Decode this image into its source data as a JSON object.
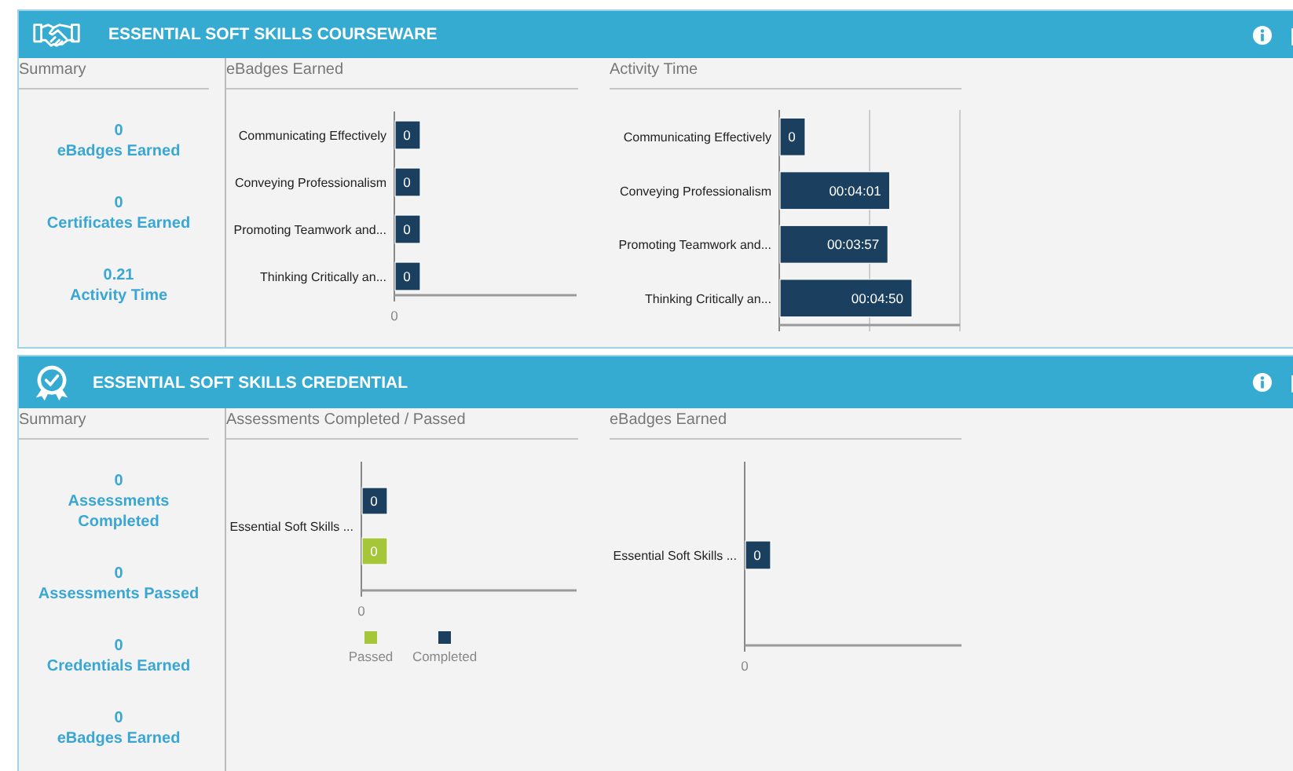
{
  "panels": [
    {
      "kind": "handshake",
      "title": "ESSENTIAL SOFT SKILLS COURSEWARE",
      "summary_title": "Summary",
      "summary": [
        {
          "value": "0",
          "label": "eBadges Earned"
        },
        {
          "value": "0",
          "label": "Certificates Earned"
        },
        {
          "value": "0.21",
          "label": "Activity Time"
        }
      ],
      "charts": [
        {
          "title": "eBadges Earned",
          "axis_origin": "0",
          "rows": [
            {
              "category": "Communicating Effectively",
              "bars": [
                {
                  "value": "0",
                  "color": "#1b3f5e"
                }
              ]
            },
            {
              "category": "Conveying Professionalism",
              "bars": [
                {
                  "value": "0",
                  "color": "#1b3f5e"
                }
              ]
            },
            {
              "category": "Promoting Teamwork and...",
              "bars": [
                {
                  "value": "0",
                  "color": "#1b3f5e"
                }
              ]
            },
            {
              "category": "Thinking Critically an...",
              "bars": [
                {
                  "value": "0",
                  "color": "#1b3f5e"
                }
              ]
            }
          ]
        },
        {
          "title": "Activity Time",
          "rows": [
            {
              "category": "Communicating Effectively",
              "bars": [
                {
                  "value": "0",
                  "color": "#1b3f5e"
                }
              ]
            },
            {
              "category": "Conveying Professionalism",
              "bars": [
                {
                  "value": "00:04:01",
                  "color": "#1b3f5e"
                }
              ]
            },
            {
              "category": "Promoting Teamwork and...",
              "bars": [
                {
                  "value": "00:03:57",
                  "color": "#1b3f5e"
                }
              ]
            },
            {
              "category": "Thinking Critically an...",
              "bars": [
                {
                  "value": "00:04:50",
                  "color": "#1b3f5e"
                }
              ]
            }
          ]
        }
      ]
    },
    {
      "kind": "award",
      "title": "ESSENTIAL SOFT SKILLS CREDENTIAL",
      "summary_title": "Summary",
      "summary": [
        {
          "value": "0",
          "label": "Assessments Completed"
        },
        {
          "value": "0",
          "label": "Assessments Passed"
        },
        {
          "value": "0",
          "label": "Credentials Earned"
        },
        {
          "value": "0",
          "label": "eBadges Earned"
        }
      ],
      "charts": [
        {
          "title": "Assessments Completed / Passed",
          "axis_origin": "0",
          "rows": [
            {
              "category": "Essential Soft Skills ...",
              "bars": [
                {
                  "value": "0",
                  "color": "#1b3f5e"
                },
                {
                  "value": "0",
                  "color": "#a6c63a"
                }
              ]
            }
          ],
          "legend": [
            {
              "label": "Passed",
              "color": "#a6c63a"
            },
            {
              "label": "Completed",
              "color": "#1b3f5e"
            }
          ]
        },
        {
          "title": "eBadges Earned",
          "axis_origin": "0",
          "rows": [
            {
              "category": "Essential Soft Skills ...",
              "bars": [
                {
                  "value": "0",
                  "color": "#1b3f5e"
                }
              ]
            }
          ]
        }
      ]
    }
  ]
}
